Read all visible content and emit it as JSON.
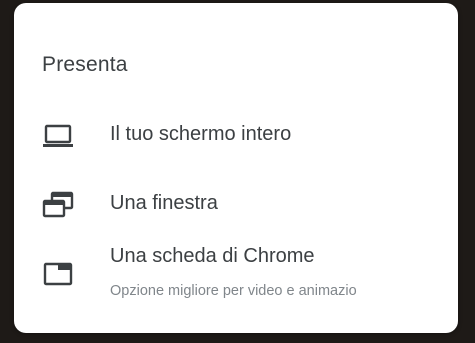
{
  "dialog": {
    "title": "Presenta",
    "items": [
      {
        "icon": "laptop-icon",
        "label": "Il tuo schermo intero"
      },
      {
        "icon": "window-icon",
        "label": "Una finestra"
      },
      {
        "icon": "tab-icon",
        "label": "Una scheda di Chrome",
        "sublabel": "Opzione migliore per video e animazio"
      }
    ]
  },
  "colors": {
    "background": "#1e1a17",
    "card": "#ffffff",
    "text": "#3c4043",
    "subtext": "#80868b",
    "icon": "#3c4043"
  }
}
